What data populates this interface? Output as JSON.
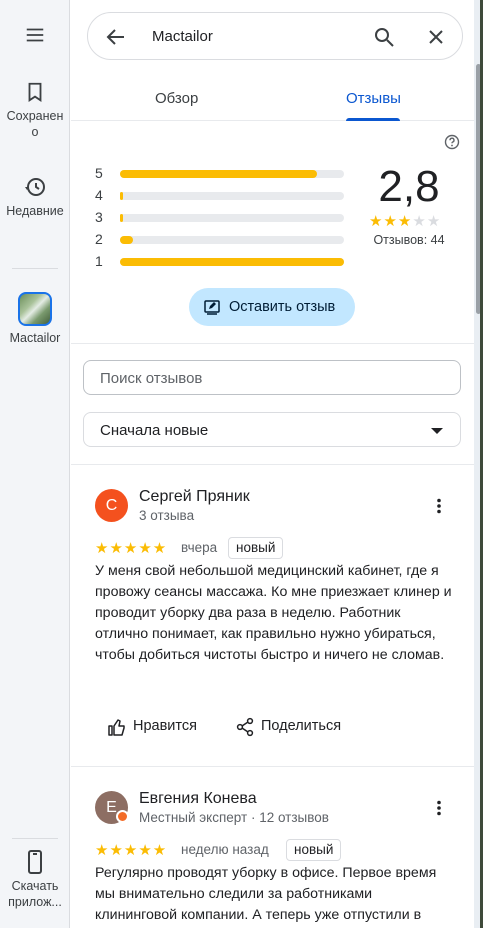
{
  "rail": {
    "saved_label": "Сохранено",
    "recent_label": "Недавние",
    "place_label": "Mactailor",
    "download_label": "Скачать прилож..."
  },
  "search": {
    "query": "Mactailor"
  },
  "tabs": [
    {
      "label": "Обзор",
      "active": false
    },
    {
      "label": "Отзывы",
      "active": true
    }
  ],
  "summary": {
    "rating": "2,8",
    "stars_filled": 3,
    "count_label": "Отзывов: 44",
    "distribution": [
      {
        "star": "5",
        "fraction": 0.88
      },
      {
        "star": "4",
        "fraction": 0.01
      },
      {
        "star": "3",
        "fraction": 0.01
      },
      {
        "star": "2",
        "fraction": 0.06
      },
      {
        "star": "1",
        "fraction": 1.0
      }
    ],
    "write_review_label": "Оставить отзыв"
  },
  "search_reviews": {
    "placeholder": "Поиск отзывов"
  },
  "sort": {
    "selected": "Сначала новые"
  },
  "reviews": [
    {
      "initial": "С",
      "avatar_color": "#f4511e",
      "name": "Сергей Пряник",
      "meta": "3 отзыва",
      "stars": "★★★★★",
      "date": "вчера",
      "badge": "новый",
      "text": "У меня свой небольшой медицинский кабинет, где я провожу сеансы массажа. Ко мне приезжает клинер и проводит уборку два раза в неделю. Работник отлично понимает, как правильно нужно убираться, чтобы добиться чистоты быстро и ничего не сломав.",
      "like_label": "Нравится",
      "share_label": "Поделиться"
    },
    {
      "initial": "Е",
      "avatar_color": "#8d6e63",
      "name": "Евгения Конева",
      "meta": "Местный эксперт · 12 отзывов",
      "stars": "★★★★★",
      "date": "неделю назад",
      "badge": "новый",
      "text": "Регулярно проводят уборку в офисе. Первое время мы внимательно следили за работниками клининговой компании. А теперь уже отпустили в"
    }
  ]
}
